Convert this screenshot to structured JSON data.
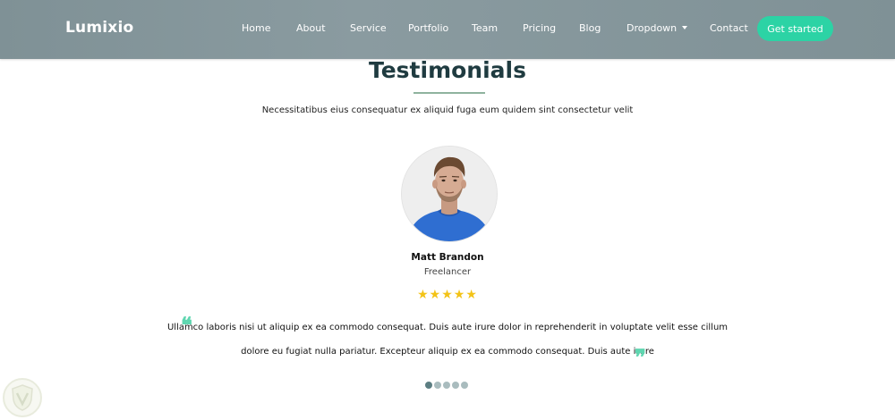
{
  "header": {
    "brand": "Lumixio",
    "nav": [
      {
        "label": "Home"
      },
      {
        "label": "About"
      },
      {
        "label": "Service"
      },
      {
        "label": "Portfolio"
      },
      {
        "label": "Team"
      },
      {
        "label": "Pricing"
      },
      {
        "label": "Blog"
      },
      {
        "label": "Dropdown",
        "has_caret": true
      },
      {
        "label": "Contact"
      }
    ],
    "cta_label": "Get started",
    "colors": {
      "navbar": "#83959a",
      "cta": "#2cd3a5"
    }
  },
  "testimonials": {
    "title": "Testimonials",
    "subtitle": "Necessitatibus eius consequatur ex aliquid fuga eum quidem sint consectetur velit",
    "item": {
      "name": "Matt Brandon",
      "role": "Freelancer",
      "rating": 5,
      "rating_max": 5,
      "stars_text": "★★★★★",
      "quote_line_1": "Ullamco laboris nisi ut aliquip ex ea commodo consequat. Duis aute irure dolor in reprehenderit in voluptate velit esse cillum",
      "quote_line_2": "dolore eu fugiat nulla pariatur. Excepteur aliquip ex ea commodo consequat. Duis aute irure",
      "quote_open_glyph": "❝",
      "quote_close_glyph": "❞",
      "avatar_icon": "person-avatar"
    },
    "pagination": {
      "count": 5,
      "active_index": 0
    },
    "colors": {
      "title": "#1f3b40",
      "rule": "#8fb39e",
      "stars": "#f3c317",
      "quotes": "#5fd6b0"
    }
  }
}
